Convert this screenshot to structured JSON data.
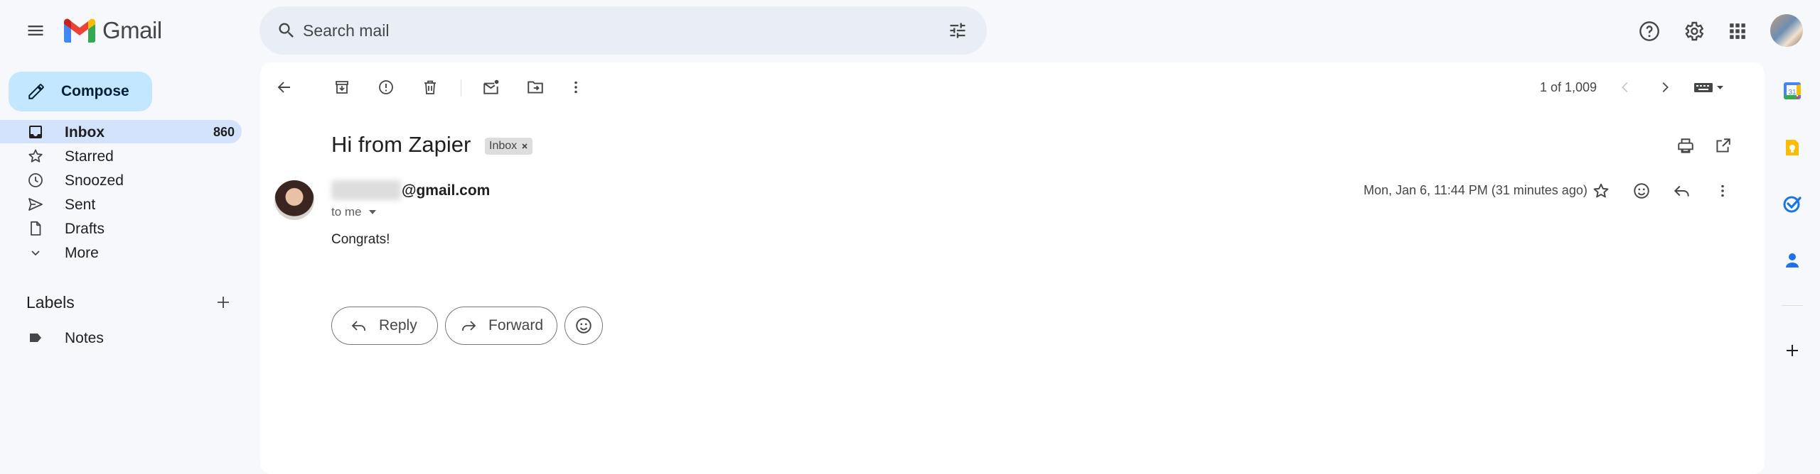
{
  "header": {
    "app_name": "Gmail",
    "search_placeholder": "Search mail"
  },
  "sidebar": {
    "compose_label": "Compose",
    "items": [
      {
        "label": "Inbox",
        "count": "860",
        "icon": "inbox-icon"
      },
      {
        "label": "Starred",
        "icon": "star-icon"
      },
      {
        "label": "Snoozed",
        "icon": "clock-icon"
      },
      {
        "label": "Sent",
        "icon": "send-icon"
      },
      {
        "label": "Drafts",
        "icon": "draft-icon"
      },
      {
        "label": "More",
        "icon": "chevron-down-icon"
      }
    ],
    "labels_heading": "Labels",
    "labels": [
      {
        "label": "Notes",
        "icon": "label-icon"
      }
    ]
  },
  "toolbar": {
    "pager": "1 of 1,009"
  },
  "message": {
    "subject": "Hi from Zapier",
    "chip_label": "Inbox",
    "sender_email": "@gmail.com",
    "recipient": "to me",
    "datetime": "Mon, Jan 6, 11:44 PM (31 minutes ago)",
    "body": "Congrats!"
  },
  "actions": {
    "reply_label": "Reply",
    "forward_label": "Forward"
  },
  "colors": {
    "background": "#f6f8fc",
    "compose": "#c2e7ff",
    "inbox_selected": "#d3e3fd",
    "search": "#e9eef6"
  }
}
